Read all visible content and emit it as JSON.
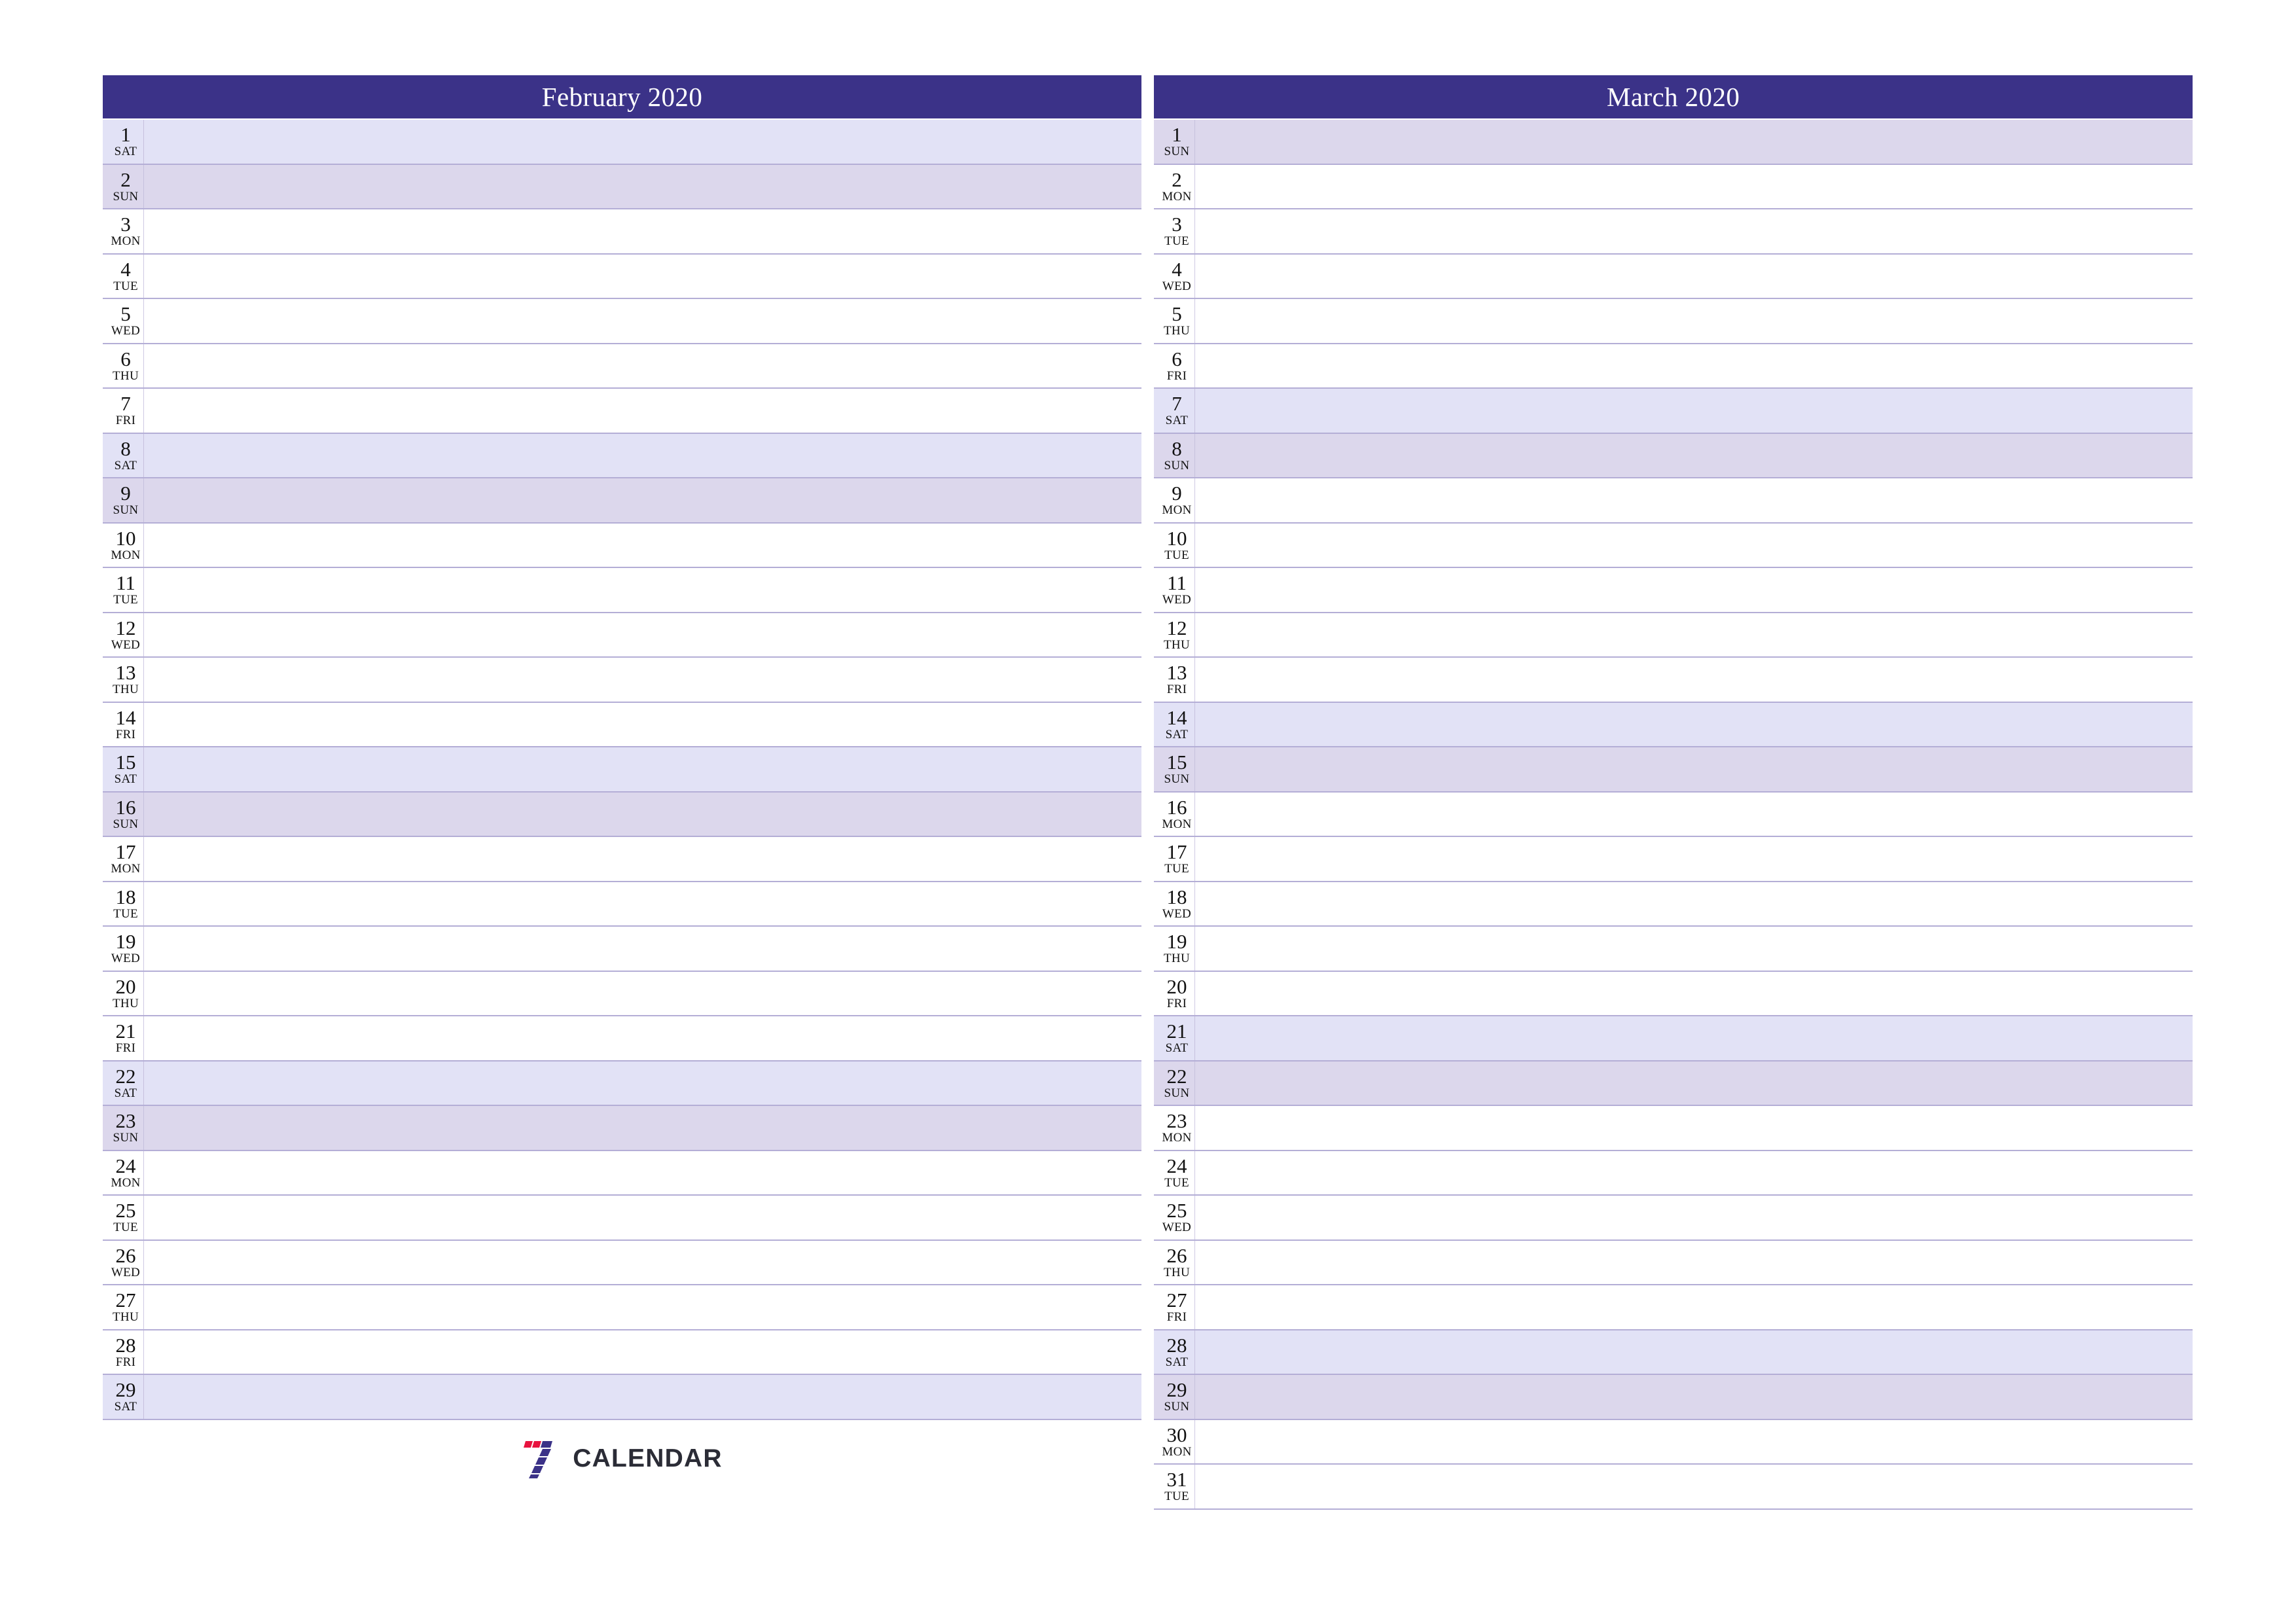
{
  "document": {
    "type": "printable-monthly-planner",
    "orientation": "landscape"
  },
  "brand": {
    "name": "CALENDAR",
    "logo_icon": "seven-logo-icon",
    "colors": {
      "red": "#e8133f",
      "blue": "#3b3288",
      "text": "#2b2c36"
    }
  },
  "theme": {
    "header_background": "#3b3288",
    "header_text": "#ffffff",
    "saturday_background": "#e2e2f6",
    "sunday_background": "#dcd7ec",
    "weekday_background": "#ffffff",
    "row_border": "#b4aed6",
    "page_background": "#ffffff"
  },
  "months": [
    {
      "title": "February 2020",
      "days": [
        {
          "num": "1",
          "dow": "SAT"
        },
        {
          "num": "2",
          "dow": "SUN"
        },
        {
          "num": "3",
          "dow": "MON"
        },
        {
          "num": "4",
          "dow": "TUE"
        },
        {
          "num": "5",
          "dow": "WED"
        },
        {
          "num": "6",
          "dow": "THU"
        },
        {
          "num": "7",
          "dow": "FRI"
        },
        {
          "num": "8",
          "dow": "SAT"
        },
        {
          "num": "9",
          "dow": "SUN"
        },
        {
          "num": "10",
          "dow": "MON"
        },
        {
          "num": "11",
          "dow": "TUE"
        },
        {
          "num": "12",
          "dow": "WED"
        },
        {
          "num": "13",
          "dow": "THU"
        },
        {
          "num": "14",
          "dow": "FRI"
        },
        {
          "num": "15",
          "dow": "SAT"
        },
        {
          "num": "16",
          "dow": "SUN"
        },
        {
          "num": "17",
          "dow": "MON"
        },
        {
          "num": "18",
          "dow": "TUE"
        },
        {
          "num": "19",
          "dow": "WED"
        },
        {
          "num": "20",
          "dow": "THU"
        },
        {
          "num": "21",
          "dow": "FRI"
        },
        {
          "num": "22",
          "dow": "SAT"
        },
        {
          "num": "23",
          "dow": "SUN"
        },
        {
          "num": "24",
          "dow": "MON"
        },
        {
          "num": "25",
          "dow": "TUE"
        },
        {
          "num": "26",
          "dow": "WED"
        },
        {
          "num": "27",
          "dow": "THU"
        },
        {
          "num": "28",
          "dow": "FRI"
        },
        {
          "num": "29",
          "dow": "SAT"
        }
      ]
    },
    {
      "title": "March 2020",
      "days": [
        {
          "num": "1",
          "dow": "SUN"
        },
        {
          "num": "2",
          "dow": "MON"
        },
        {
          "num": "3",
          "dow": "TUE"
        },
        {
          "num": "4",
          "dow": "WED"
        },
        {
          "num": "5",
          "dow": "THU"
        },
        {
          "num": "6",
          "dow": "FRI"
        },
        {
          "num": "7",
          "dow": "SAT"
        },
        {
          "num": "8",
          "dow": "SUN"
        },
        {
          "num": "9",
          "dow": "MON"
        },
        {
          "num": "10",
          "dow": "TUE"
        },
        {
          "num": "11",
          "dow": "WED"
        },
        {
          "num": "12",
          "dow": "THU"
        },
        {
          "num": "13",
          "dow": "FRI"
        },
        {
          "num": "14",
          "dow": "SAT"
        },
        {
          "num": "15",
          "dow": "SUN"
        },
        {
          "num": "16",
          "dow": "MON"
        },
        {
          "num": "17",
          "dow": "TUE"
        },
        {
          "num": "18",
          "dow": "WED"
        },
        {
          "num": "19",
          "dow": "THU"
        },
        {
          "num": "20",
          "dow": "FRI"
        },
        {
          "num": "21",
          "dow": "SAT"
        },
        {
          "num": "22",
          "dow": "SUN"
        },
        {
          "num": "23",
          "dow": "MON"
        },
        {
          "num": "24",
          "dow": "TUE"
        },
        {
          "num": "25",
          "dow": "WED"
        },
        {
          "num": "26",
          "dow": "THU"
        },
        {
          "num": "27",
          "dow": "FRI"
        },
        {
          "num": "28",
          "dow": "SAT"
        },
        {
          "num": "29",
          "dow": "SUN"
        },
        {
          "num": "30",
          "dow": "MON"
        },
        {
          "num": "31",
          "dow": "TUE"
        }
      ]
    }
  ]
}
